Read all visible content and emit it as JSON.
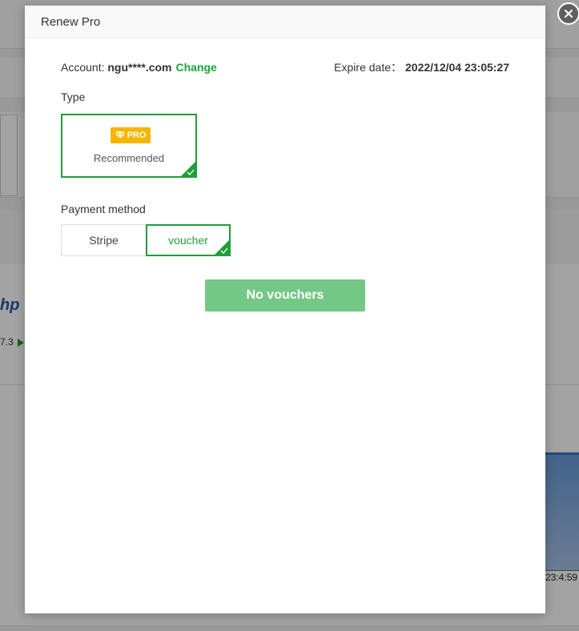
{
  "background": {
    "fragment_logo": "hp",
    "fragment_number": "7.3",
    "chart_tick": "23:4:59"
  },
  "modal": {
    "title": "Renew Pro",
    "close_icon": "close-icon",
    "account": {
      "label": "Account: ",
      "value": "ngu****.com",
      "change_link": "Change"
    },
    "expire": {
      "label": "Expire date：",
      "value": "2022/12/04 23:05:27"
    },
    "type_section": {
      "label": "Type",
      "card": {
        "badge_icon": "diamond-icon",
        "badge_text": "PRO",
        "caption": "Recommended",
        "selected": true
      }
    },
    "payment_section": {
      "label": "Payment method",
      "options": [
        {
          "label": "Stripe",
          "selected": false
        },
        {
          "label": "voucher",
          "selected": true
        }
      ]
    },
    "action_button": "No vouchers"
  },
  "colors": {
    "accent_green": "#1e9e3a",
    "button_green": "#74c886",
    "badge_gold": "#f7b500"
  }
}
